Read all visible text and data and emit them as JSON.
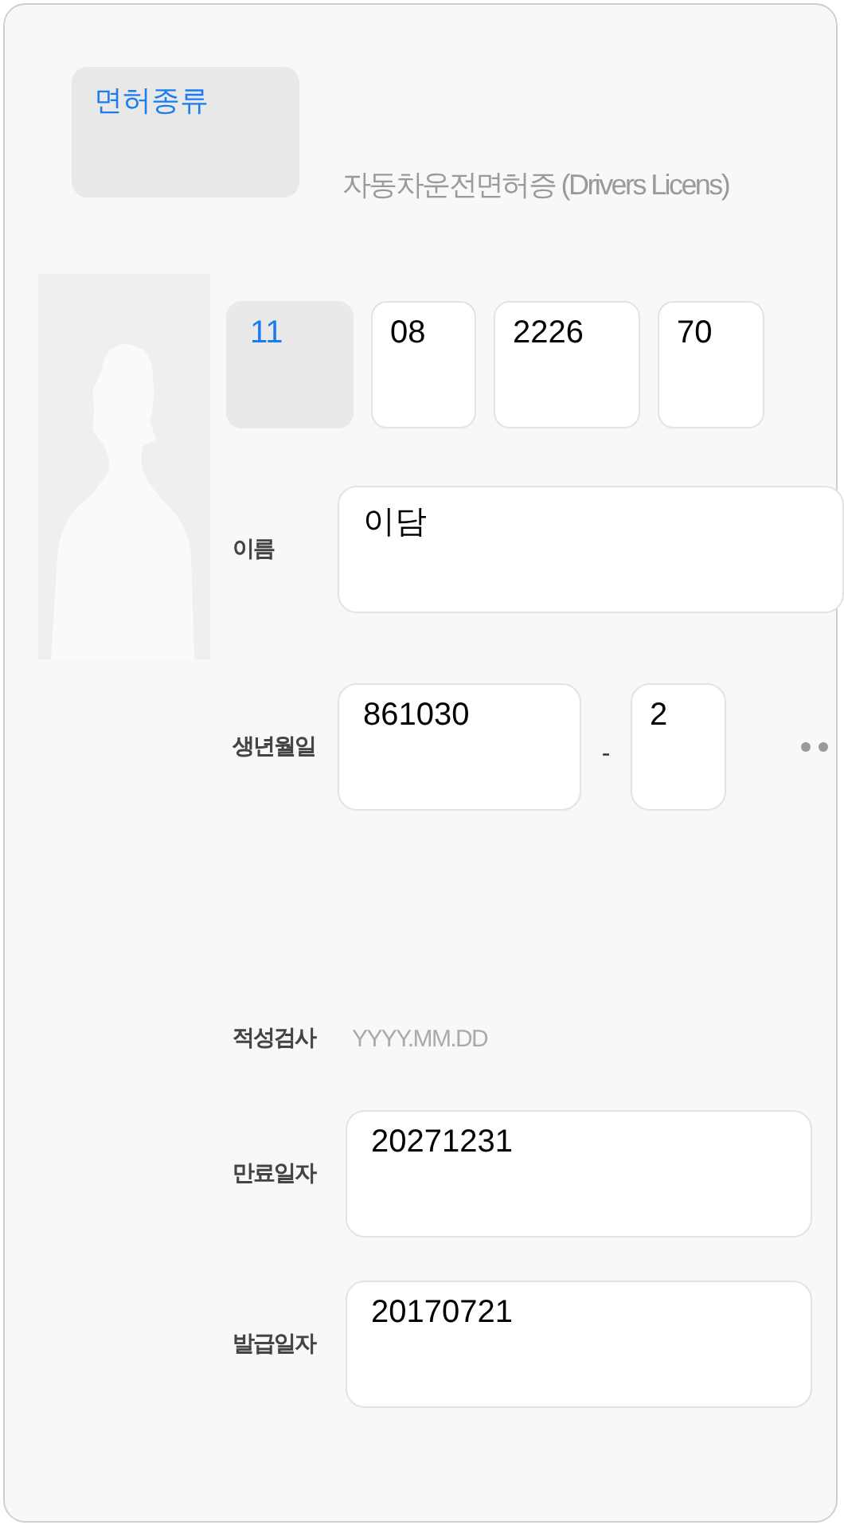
{
  "license_type_button": {
    "label": "면허종류"
  },
  "card_title": "자동차운전면허증 (Drivers Licens)",
  "license_number": [
    {
      "kind": "select",
      "value": "11"
    },
    {
      "kind": "input",
      "value": "08"
    },
    {
      "kind": "input",
      "value": "2226"
    },
    {
      "kind": "input",
      "value": "70"
    }
  ],
  "fields": [
    {
      "kind": "text",
      "label": "이름",
      "value": "이담"
    },
    {
      "kind": "rrn",
      "label": "생년월일",
      "front": "861030",
      "separator": "-",
      "back": "2"
    },
    {
      "kind": "placeholder",
      "label": "적성검사",
      "placeholder": "YYYY.MM.DD"
    },
    {
      "kind": "text",
      "label": "만료일자",
      "value": "20271231"
    },
    {
      "kind": "text",
      "label": "발급일자",
      "value": "20170721"
    }
  ]
}
